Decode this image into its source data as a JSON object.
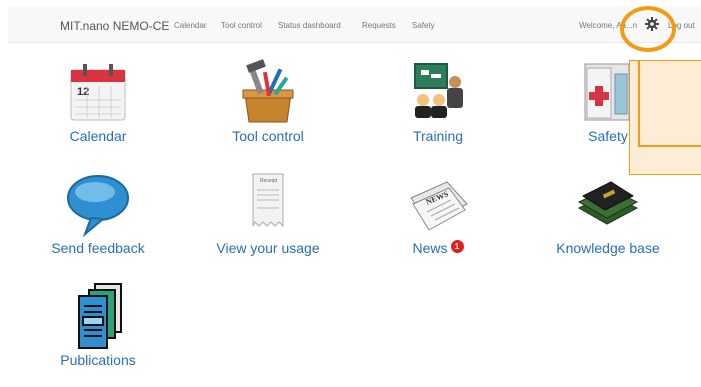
{
  "navbar": {
    "brand": "MIT.nano NEMO-CE",
    "links": [
      "Calendar",
      "Tool control",
      "Status dashboard",
      "Requests",
      "Safety"
    ],
    "welcome": "Welcome, Aa...n",
    "logout": "Log out"
  },
  "tiles": [
    {
      "label": "Calendar",
      "icon": "calendar-icon"
    },
    {
      "label": "Tool control",
      "icon": "toolbox-icon"
    },
    {
      "label": "Training",
      "icon": "training-icon"
    },
    {
      "label": "Safety",
      "icon": "safety-cabinet-icon"
    },
    {
      "label": "Send feedback",
      "icon": "speech-bubble-icon"
    },
    {
      "label": "View your usage",
      "icon": "receipt-icon"
    },
    {
      "label": "News",
      "icon": "newspaper-icon",
      "badge": "1"
    },
    {
      "label": "Knowledge base",
      "icon": "books-icon"
    },
    {
      "label": "Publications",
      "icon": "documents-icon"
    }
  ],
  "colors": {
    "link": "#2a6ebb",
    "badge": "#e0201f",
    "highlight": "#f39c12"
  }
}
